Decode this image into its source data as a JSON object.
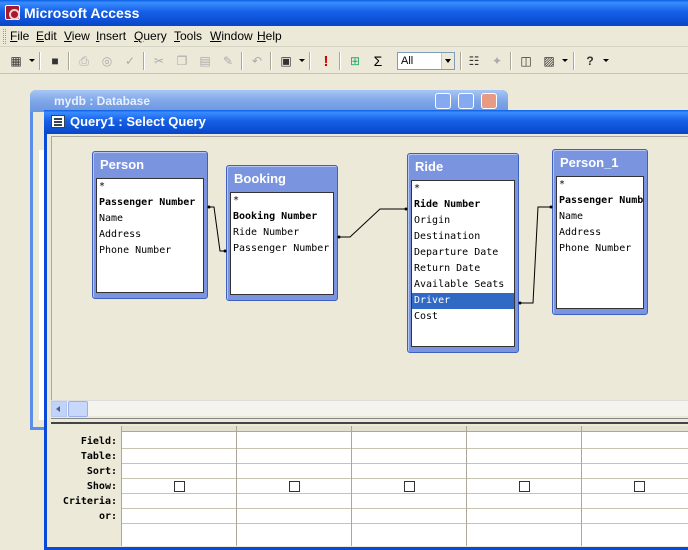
{
  "app": {
    "title": "Microsoft Access"
  },
  "menu": [
    {
      "key": "F",
      "rest": "ile"
    },
    {
      "key": "E",
      "rest": "dit"
    },
    {
      "key": "V",
      "rest": "iew"
    },
    {
      "key": "I",
      "rest": "nsert"
    },
    {
      "key": "Q",
      "rest": "uery"
    },
    {
      "key": "T",
      "rest": "ools"
    },
    {
      "key": "W",
      "rest": "indow"
    },
    {
      "key": "H",
      "rest": "elp"
    }
  ],
  "toolbar": {
    "top_values": "All",
    "icons": [
      "view-icon",
      "save-icon",
      "print-icon",
      "print-preview-icon",
      "spelling-icon",
      "cut-icon",
      "copy-icon",
      "paste-icon",
      "format-painter-icon",
      "undo-icon",
      "query-type-icon",
      "run-icon",
      "show-table-icon",
      "totals-icon",
      "top-values-combo",
      "properties-icon",
      "build-icon",
      "database-window-icon",
      "new-object-icon",
      "help-icon"
    ]
  },
  "db_window": {
    "title": "mydb : Database"
  },
  "query_window": {
    "title": "Query1 : Select Query"
  },
  "tables": [
    {
      "name": "Person",
      "fields": [
        "*",
        "Passenger Number",
        "Name",
        "Address",
        "Phone Number"
      ],
      "key_field": 1
    },
    {
      "name": "Booking",
      "fields": [
        "*",
        "Booking Number",
        "Ride Number",
        "Passenger Number"
      ],
      "key_field": 1
    },
    {
      "name": "Ride",
      "fields": [
        "*",
        "Ride Number",
        "Origin",
        "Destination",
        "Departure Date",
        "Return Date",
        "Available Seats",
        "Driver",
        "Cost"
      ],
      "key_field": 1,
      "selected_field": 7
    },
    {
      "name": "Person_1",
      "fields": [
        "*",
        "Passenger Numb",
        "Name",
        "Address",
        "Phone Number"
      ],
      "key_field": 1
    }
  ],
  "grid": {
    "row_labels": [
      "Field:",
      "Table:",
      "Sort:",
      "Show:",
      "Criteria:",
      "or:"
    ],
    "columns": 5
  },
  "colors": {
    "titlebar": "#0746c8",
    "field_list": "#7a94e0",
    "selection": "#316ac5"
  }
}
